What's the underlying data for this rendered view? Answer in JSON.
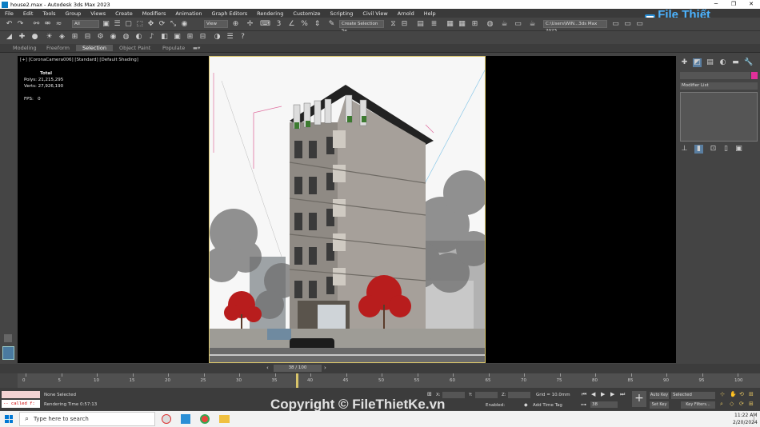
{
  "window": {
    "title": "house2.max - Autodesk 3ds Max 2023"
  },
  "menu": [
    "File",
    "Edit",
    "Tools",
    "Group",
    "Views",
    "Create",
    "Modifiers",
    "Animation",
    "Graph Editors",
    "Rendering",
    "Customize",
    "Scripting",
    "Civil View",
    "Arnold",
    "Help"
  ],
  "toolbar": {
    "filter_all": "All",
    "view_dropdown": "View",
    "selection_set": "Create Selection Se",
    "path": "C:\\Users\\WIN...3ds Max 2023"
  },
  "ribbon_tabs": [
    "Modeling",
    "Freeform",
    "Selection",
    "Object Paint",
    "Populate"
  ],
  "ribbon_active": "Selection",
  "viewport": {
    "label": "[+] [CoronaCamera006] [Standard] [Default Shading]",
    "stats": {
      "total_label": "Total",
      "polys_label": "Polys:",
      "polys": "21,215,295",
      "verts_label": "Verts:",
      "verts": "27,926,190",
      "fps_label": "FPS:",
      "fps": "0"
    }
  },
  "command_panel": {
    "modifier_list": "Modifier List"
  },
  "timeline": {
    "frame_counter": "38 / 100",
    "ticks": [
      "0",
      "5",
      "10",
      "15",
      "20",
      "25",
      "30",
      "35",
      "40",
      "45",
      "50",
      "55",
      "60",
      "65",
      "70",
      "75",
      "80",
      "85",
      "90",
      "95",
      "100"
    ],
    "current_frame": 38
  },
  "status": {
    "maxscript": "-- called f:",
    "selection": "None Selected",
    "rendering_time": "Rendering Time  0:57:13",
    "x_label": "X:",
    "y_label": "Y:",
    "z_label": "Z:",
    "grid": "Grid = 10.0mm",
    "enabled": "Enabled:",
    "add_time_tag": "Add Time Tag",
    "auto_key": "Auto Key",
    "set_key": "Set Key",
    "selected_dropdown": "Selected",
    "key_filters": "Key Filters...",
    "frame_field": "38"
  },
  "taskbar": {
    "search_placeholder": "Type here to search",
    "time": "11:22 AM",
    "date": "2/20/2024"
  },
  "logo": {
    "text": "File Thiết Kế.vn"
  },
  "watermark": "Copyright © FileThietKe.vn",
  "colors": {
    "accent": "#0d7ec4",
    "viewport_border": "#d8c46a",
    "magenta_swatch": "#e0309a"
  }
}
